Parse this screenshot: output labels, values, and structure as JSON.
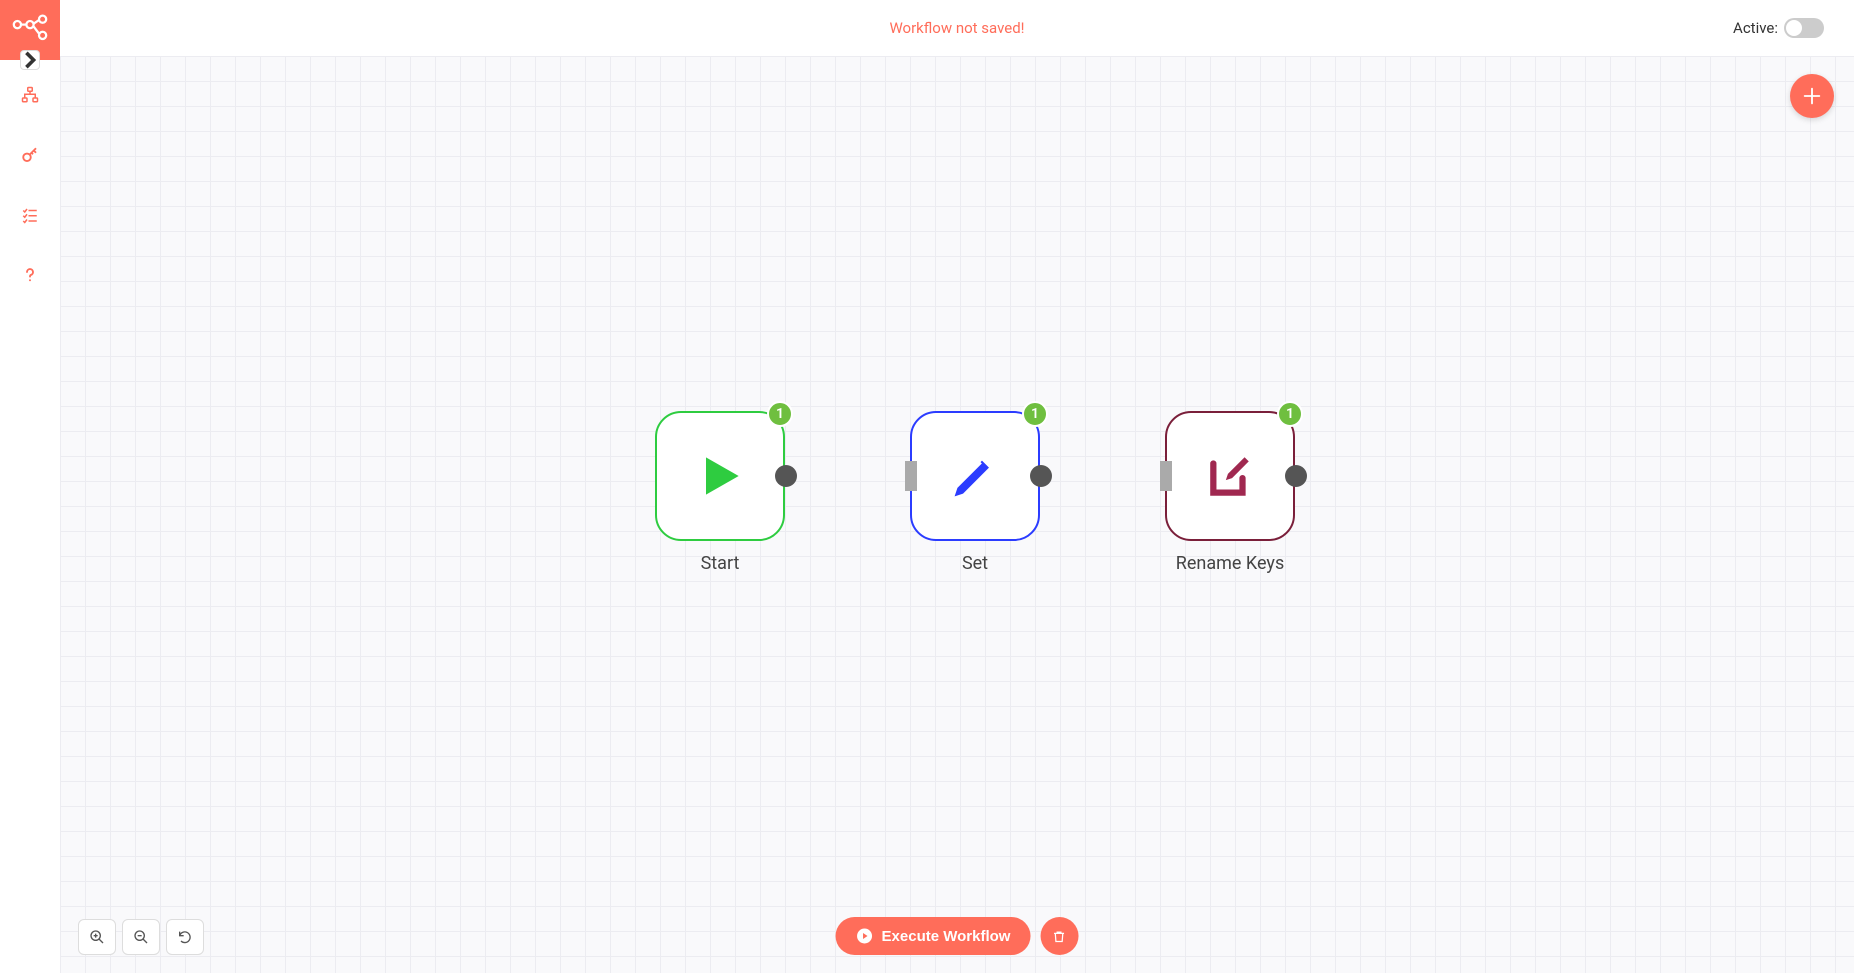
{
  "header": {
    "warning": "Workflow not saved!",
    "active_label": "Active:"
  },
  "nodes": [
    {
      "label": "Start",
      "badge": "1"
    },
    {
      "label": "Set",
      "badge": "1"
    },
    {
      "label": "Rename Keys",
      "badge": "1"
    }
  ],
  "buttons": {
    "execute": "Execute Workflow"
  },
  "colors": {
    "accent": "#ff6d5a",
    "node_start": "#2ecc40",
    "node_set": "#2b3cff",
    "node_rename": "#7a1f3a",
    "badge": "#6fbf3f"
  }
}
